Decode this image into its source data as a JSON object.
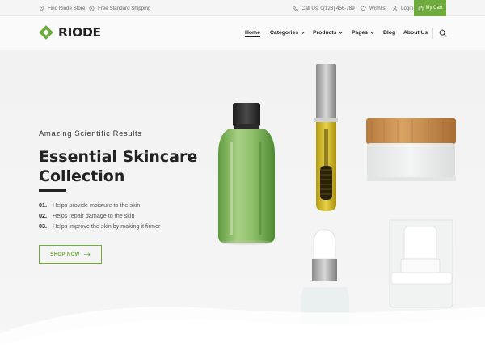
{
  "topbar": {
    "store": "Find Riode Store",
    "shipping": "Free Standard Shipping",
    "phone": "Call Us: 0(123) 456-789",
    "wishlist": "Wishlist",
    "login": "Login",
    "cart": "My Cart"
  },
  "brand": {
    "name": "RIODE",
    "accent_color": "#6fab3c"
  },
  "nav": {
    "items": [
      {
        "label": "Home",
        "active": true
      },
      {
        "label": "Categories",
        "dropdown": true
      },
      {
        "label": "Products",
        "dropdown": true
      },
      {
        "label": "Pages",
        "dropdown": true
      },
      {
        "label": "Blog"
      },
      {
        "label": "About Us"
      }
    ]
  },
  "hero": {
    "subtitle": "Amazing Scientific Results",
    "title_line1": "Essential Skincare",
    "title_line2": "Collection",
    "benefits": [
      {
        "num": "01.",
        "text": "Helps provide moisture to the skin."
      },
      {
        "num": "02.",
        "text": "Helps repair damage to the skin"
      },
      {
        "num": "03.",
        "text": "Helps improve the skin by making it firmer"
      }
    ],
    "cta": "SHOP NOW"
  }
}
